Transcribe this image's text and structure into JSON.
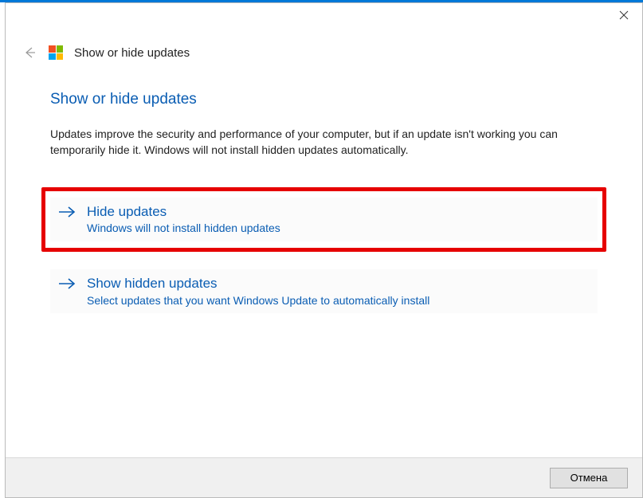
{
  "header": {
    "title": "Show or hide updates"
  },
  "page": {
    "heading": "Show or hide updates",
    "description": "Updates improve the security and performance of your computer, but if an update isn't working you can temporarily hide it. Windows will not install hidden updates automatically."
  },
  "options": [
    {
      "title": "Hide updates",
      "subtitle": "Windows will not install hidden updates"
    },
    {
      "title": "Show hidden updates",
      "subtitle": "Select updates that you want Windows Update to automatically install"
    }
  ],
  "footer": {
    "cancel": "Отмена"
  }
}
